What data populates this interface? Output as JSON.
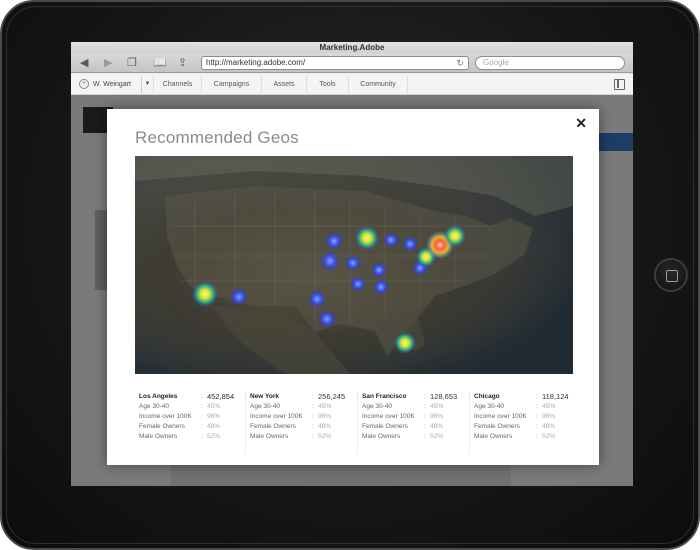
{
  "browser": {
    "title": "Marketing.Adobe",
    "url": "http://marketing.adobe.com/",
    "search_placeholder": "Google"
  },
  "sitenav": {
    "user": "W. Weingart",
    "items": [
      "Channels",
      "Campaigns",
      "Assets",
      "Tools",
      "Community"
    ]
  },
  "modal": {
    "title": "Recommended Geos",
    "close_glyph": "✕"
  },
  "cities": [
    {
      "name": "Los Angeles",
      "total": "452,854",
      "stats": [
        {
          "label": "Age 30-40",
          "value": "45%"
        },
        {
          "label": "Income over 100K",
          "value": "98%"
        },
        {
          "label": "Female Owners",
          "value": "48%"
        },
        {
          "label": "Male Owners",
          "value": "52%"
        }
      ]
    },
    {
      "name": "New York",
      "total": "256,245",
      "stats": [
        {
          "label": "Age 30-40",
          "value": "45%"
        },
        {
          "label": "Income over 100K",
          "value": "98%"
        },
        {
          "label": "Female Owners",
          "value": "48%"
        },
        {
          "label": "Male Owners",
          "value": "52%"
        }
      ]
    },
    {
      "name": "San Francisco",
      "total": "128,653",
      "stats": [
        {
          "label": "Age 30-40",
          "value": "45%"
        },
        {
          "label": "Income over 100K",
          "value": "98%"
        },
        {
          "label": "Female Owners",
          "value": "48%"
        },
        {
          "label": "Male Owners",
          "value": "52%"
        }
      ]
    },
    {
      "name": "Chicago",
      "total": "118,124",
      "stats": [
        {
          "label": "Age 30-40",
          "value": "45%"
        },
        {
          "label": "Income over 100K",
          "value": "98%"
        },
        {
          "label": "Female Owners",
          "value": "48%"
        },
        {
          "label": "Male Owners",
          "value": "52%"
        }
      ]
    }
  ],
  "heat_colors": {
    "cool": "#3a57ff",
    "warm": "#f5e03a",
    "hot": "#ff5a3c"
  }
}
